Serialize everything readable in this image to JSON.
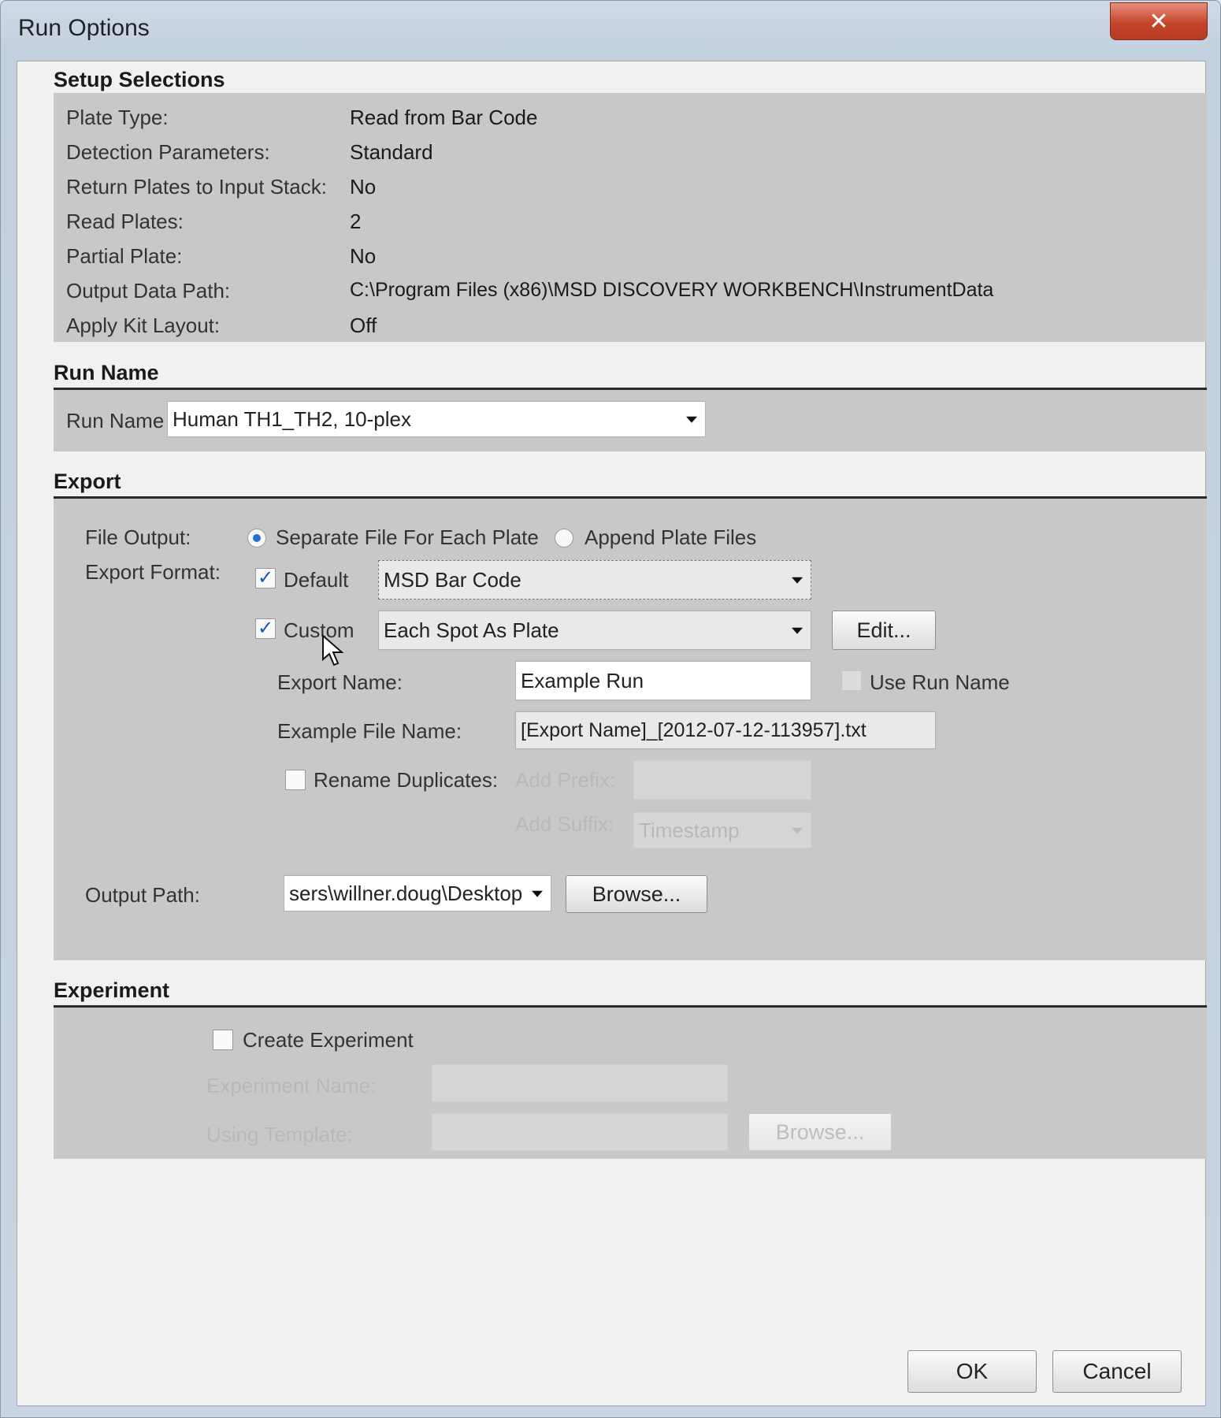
{
  "window": {
    "title": "Run Options",
    "close_label": "✕"
  },
  "setup": {
    "title": "Setup Selections",
    "rows": [
      {
        "label": "Plate Type:",
        "value": "Read from Bar Code"
      },
      {
        "label": "Detection Parameters:",
        "value": "Standard"
      },
      {
        "label": "Return Plates to Input Stack:",
        "value": "No"
      },
      {
        "label": "Read Plates:",
        "value": "2"
      },
      {
        "label": "Partial Plate:",
        "value": "No"
      },
      {
        "label": "Output Data Path:",
        "value": "C:\\Program Files (x86)\\MSD DISCOVERY WORKBENCH\\InstrumentData"
      },
      {
        "label": "Apply Kit Layout:",
        "value": "Off"
      }
    ]
  },
  "run_name": {
    "title": "Run Name",
    "label": "Run Name",
    "value": "Human TH1_TH2, 10-plex"
  },
  "export": {
    "title": "Export",
    "file_output_label": "File Output:",
    "radio_separate": "Separate File For Each Plate",
    "radio_append": "Append Plate Files",
    "export_format_label": "Export Format:",
    "default_label": "Default",
    "default_value": "MSD Bar Code",
    "custom_label": "Custom",
    "custom_value": "Each Spot As Plate",
    "edit_button": "Edit...",
    "export_name_label": "Export Name:",
    "export_name_value": "Example Run",
    "use_run_name_label": "Use Run Name",
    "example_file_label": "Example File Name:",
    "example_file_value": "[Export Name]_[2012-07-12-113957].txt",
    "rename_duplicates_label": "Rename Duplicates:",
    "add_prefix_label": "Add Prefix:",
    "add_suffix_label": "Add Suffix:",
    "add_suffix_value": "Timestamp",
    "output_path_label": "Output Path:",
    "output_path_value": "sers\\willner.doug\\Desktop",
    "browse_button": "Browse..."
  },
  "experiment": {
    "title": "Experiment",
    "create_label": "Create Experiment",
    "name_label": "Experiment Name:",
    "template_label": "Using Template:",
    "browse_button": "Browse..."
  },
  "footer": {
    "ok": "OK",
    "cancel": "Cancel"
  },
  "colors": {
    "panel": "#c8c8c8",
    "check_blue": "#1f4fb0",
    "close_red": "#c5452c"
  }
}
